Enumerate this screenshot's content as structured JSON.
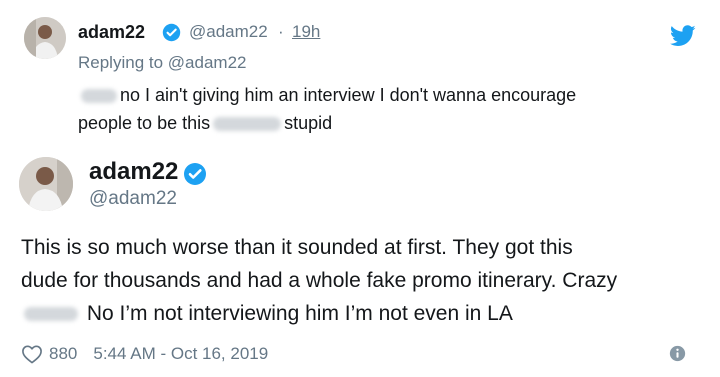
{
  "reply_tweet": {
    "display_name": "adam22",
    "handle": "@adam22",
    "separator": "·",
    "time": "19h",
    "replying_to_prefix": "Replying to",
    "replying_to_handle": "@adam22",
    "text_part1": "no I ain't giving him an interview I don't wanna encourage",
    "text_part2": "people to be this",
    "text_part3": "stupid"
  },
  "main_tweet": {
    "display_name": "adam22",
    "handle": "@adam22",
    "text_line1": "This is so much worse than it sounded at first. They got this",
    "text_line2": "dude for thousands and had a whole fake promo itinerary. Crazy",
    "text_line3": "No I’m not interviewing him I’m not even in LA",
    "likes": "880",
    "timestamp": "5:44 AM - Oct 16, 2019"
  },
  "colors": {
    "text": "#14171a",
    "secondary": "#657786",
    "twitter_blue": "#1da1f2",
    "heart_outline": "#657786"
  }
}
